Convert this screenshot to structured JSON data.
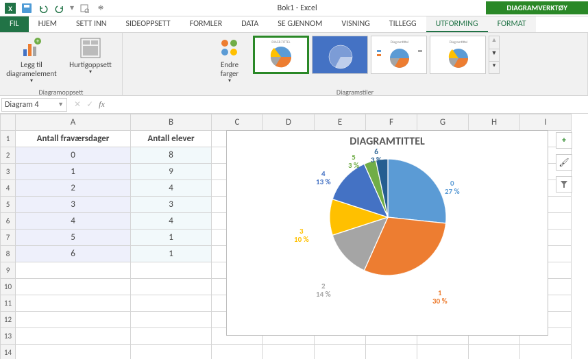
{
  "app": {
    "title": "Bok1 - Excel",
    "tooltab": "DIAGRAMVERKTØY"
  },
  "tabs": {
    "file": "FIL",
    "home": "HJEM",
    "insert": "SETT INN",
    "pagelayout": "SIDEOPPSETT",
    "formulas": "FORMLER",
    "data": "DATA",
    "review": "SE GJENNOM",
    "view": "VISNING",
    "addins": "TILLEGG",
    "design": "UTFORMING",
    "format": "FORMAT"
  },
  "ribbon": {
    "addElement": "Legg til diagramelement",
    "quickLayout": "Hurtigoppsett",
    "changeColors": "Endre farger",
    "groupLayout": "Diagramoppsett",
    "groupStyles": "Diagramstiler"
  },
  "namebox": "Diagram 4",
  "table": {
    "headerA": "Antall fraværsdager",
    "headerB": "Antall elever",
    "rows": [
      {
        "a": "0",
        "b": "8"
      },
      {
        "a": "1",
        "b": "9"
      },
      {
        "a": "2",
        "b": "4"
      },
      {
        "a": "3",
        "b": "3"
      },
      {
        "a": "4",
        "b": "4"
      },
      {
        "a": "5",
        "b": "1"
      },
      {
        "a": "6",
        "b": "1"
      }
    ]
  },
  "chart": {
    "title": "DIAGRAMTITTEL",
    "labels": {
      "s0": "0\n27 %",
      "s1": "1\n30 %",
      "s2": "2\n14 %",
      "s3": "3\n10 %",
      "s4": "4\n13 %",
      "s5": "5\n3 %",
      "s6": "6\n3 %"
    }
  },
  "colors": {
    "c0": "#5b9bd5",
    "c1": "#ed7d31",
    "c2": "#a5a5a5",
    "c3": "#ffc000",
    "c4": "#4472c4",
    "c5": "#70ad47",
    "c6": "#255e91"
  },
  "chart_data": {
    "type": "pie",
    "title": "DIAGRAMTITTEL",
    "categories": [
      "0",
      "1",
      "2",
      "3",
      "4",
      "5",
      "6"
    ],
    "values": [
      8,
      9,
      4,
      3,
      4,
      1,
      1
    ],
    "percentages": [
      27,
      30,
      14,
      10,
      13,
      3,
      3
    ],
    "colors": [
      "#5b9bd5",
      "#ed7d31",
      "#a5a5a5",
      "#ffc000",
      "#4472c4",
      "#70ad47",
      "#255e91"
    ]
  }
}
